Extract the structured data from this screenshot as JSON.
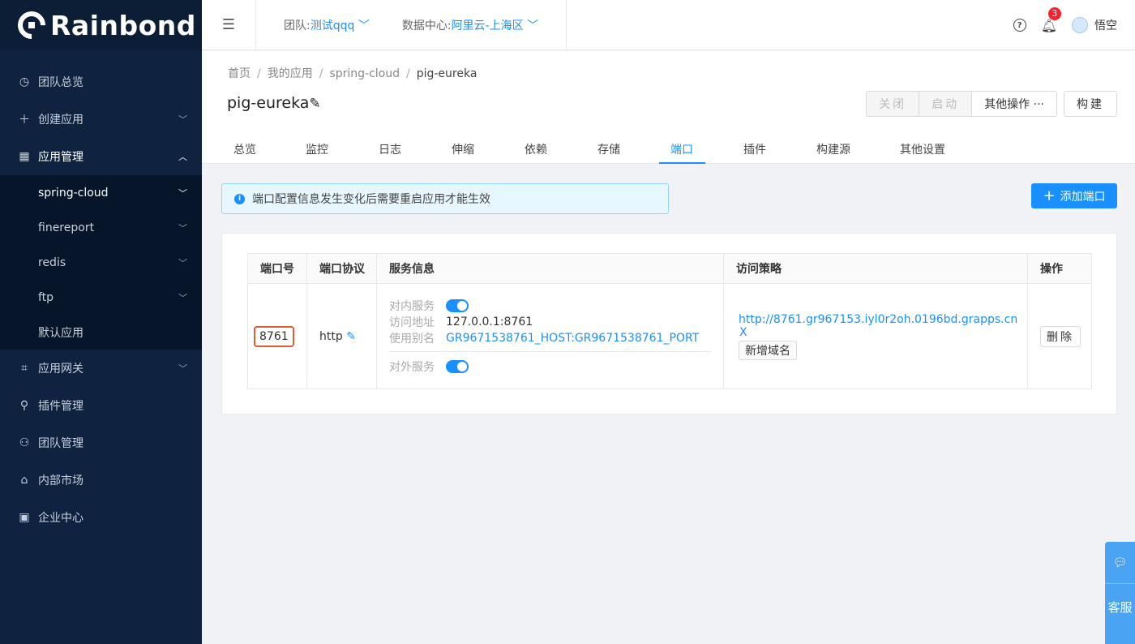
{
  "brand": {
    "name": "Rainbond"
  },
  "sidebar": {
    "items": [
      {
        "label": "团队总览",
        "icon": "dashboard-icon"
      },
      {
        "label": "创建应用",
        "icon": "plus-icon"
      },
      {
        "label": "应用管理",
        "icon": "grid-icon"
      }
    ],
    "apps": [
      "spring-cloud",
      "finereport",
      "redis",
      "ftp",
      "默认应用"
    ],
    "items_after": [
      {
        "label": "应用网关",
        "icon": "gateway-icon"
      },
      {
        "label": "插件管理",
        "icon": "plugin-icon"
      },
      {
        "label": "团队管理",
        "icon": "team-icon"
      },
      {
        "label": "内部市场",
        "icon": "market-icon"
      },
      {
        "label": "企业中心",
        "icon": "enterprise-icon"
      }
    ]
  },
  "header": {
    "team_label": "团队:",
    "team_value": "测试qqq",
    "dc_label": "数据中心:",
    "dc_value": "阿里云-上海区",
    "notification_count": "3",
    "username": "悟空"
  },
  "breadcrumb": [
    "首页",
    "我的应用",
    "spring-cloud",
    "pig-eureka"
  ],
  "page": {
    "title": "pig-eureka",
    "buttons": {
      "close": "关闭",
      "start": "启动",
      "more": "其他操作 ···",
      "build": "构建"
    }
  },
  "tabs": [
    "总览",
    "监控",
    "日志",
    "伸缩",
    "依赖",
    "存储",
    "端口",
    "插件",
    "构建源",
    "其他设置"
  ],
  "active_tab": "端口",
  "alert": {
    "text": "端口配置信息发生变化后需要重启应用才能生效"
  },
  "add_port_button": "添加端口",
  "table": {
    "headers": [
      "端口号",
      "端口协议",
      "服务信息",
      "访问策略",
      "操作"
    ],
    "row": {
      "port": "8761",
      "protocol": "http",
      "inner_service_label": "对内服务",
      "inner_enabled": true,
      "access_address_label": "访问地址",
      "access_address": "127.0.0.1:8761",
      "alias_label": "使用别名",
      "alias": "GR9671538761_HOST:GR9671538761_PORT",
      "outer_service_label": "对外服务",
      "outer_enabled": true,
      "domain": "http://8761.gr967153.iyl0r2oh.0196bd.grapps.cn",
      "remove_symbol": "X",
      "add_domain": "新增域名",
      "delete": "删除"
    }
  },
  "customer_service": {
    "label": "客服"
  },
  "colors": {
    "primary": "#1890ff",
    "sidebar": "#0f2340",
    "highlight": "#e05a34"
  }
}
